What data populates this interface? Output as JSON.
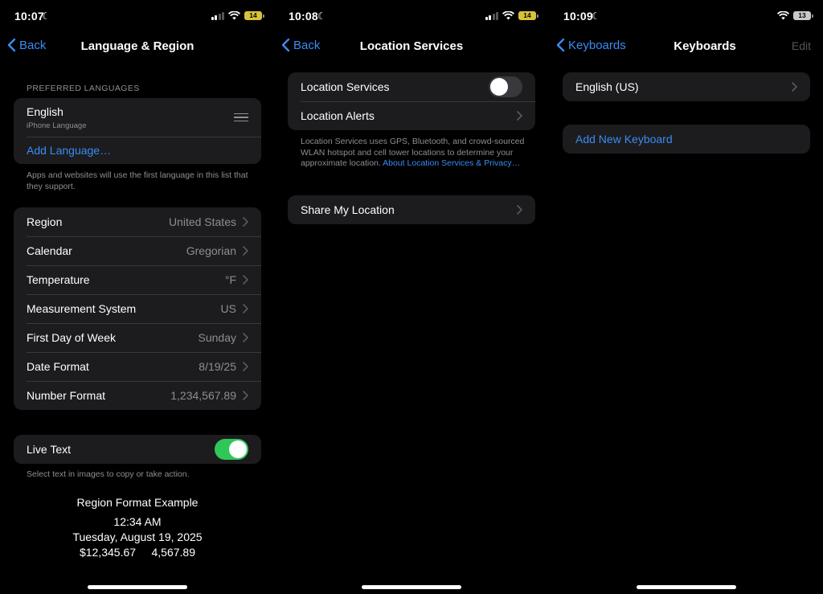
{
  "panel1": {
    "status": {
      "time": "10:07",
      "battery": "14"
    },
    "nav": {
      "back": "Back",
      "title": "Language & Region"
    },
    "preferred_header": "PREFERRED LANGUAGES",
    "language": {
      "name": "English",
      "subtitle": "iPhone Language"
    },
    "add_language": "Add Language…",
    "languages_note": "Apps and websites will use the first language in this list that they support.",
    "settings": [
      {
        "label": "Region",
        "value": "United States"
      },
      {
        "label": "Calendar",
        "value": "Gregorian"
      },
      {
        "label": "Temperature",
        "value": "°F"
      },
      {
        "label": "Measurement System",
        "value": "US"
      },
      {
        "label": "First Day of Week",
        "value": "Sunday"
      },
      {
        "label": "Date Format",
        "value": "8/19/25"
      },
      {
        "label": "Number Format",
        "value": "1,234,567.89"
      }
    ],
    "live_text": {
      "label": "Live Text",
      "enabled": true
    },
    "live_text_note": "Select text in images to copy or take action.",
    "example": {
      "title": "Region Format Example",
      "time": "12:34 AM",
      "date": "Tuesday, August 19, 2025",
      "numbers": "$12,345.67     4,567.89"
    }
  },
  "panel2": {
    "status": {
      "time": "10:08",
      "battery": "14"
    },
    "nav": {
      "back": "Back",
      "title": "Location Services"
    },
    "location_services": {
      "label": "Location Services",
      "enabled": false
    },
    "location_alerts": "Location Alerts",
    "note": "Location Services uses GPS, Bluetooth, and crowd-sourced WLAN hotspot and cell tower locations to determine your approximate location. ",
    "note_link": "About Location Services & Privacy…",
    "share_location": "Share My Location"
  },
  "panel3": {
    "status": {
      "time": "10:09",
      "battery": "13"
    },
    "nav": {
      "back": "Keyboards",
      "title": "Keyboards",
      "edit": "Edit"
    },
    "keyboard": "English (US)",
    "add_keyboard": "Add New Keyboard"
  },
  "colors": {
    "accent": "#3a8cf5",
    "toggle_on": "#30c759",
    "battery": "#d9c23a"
  }
}
